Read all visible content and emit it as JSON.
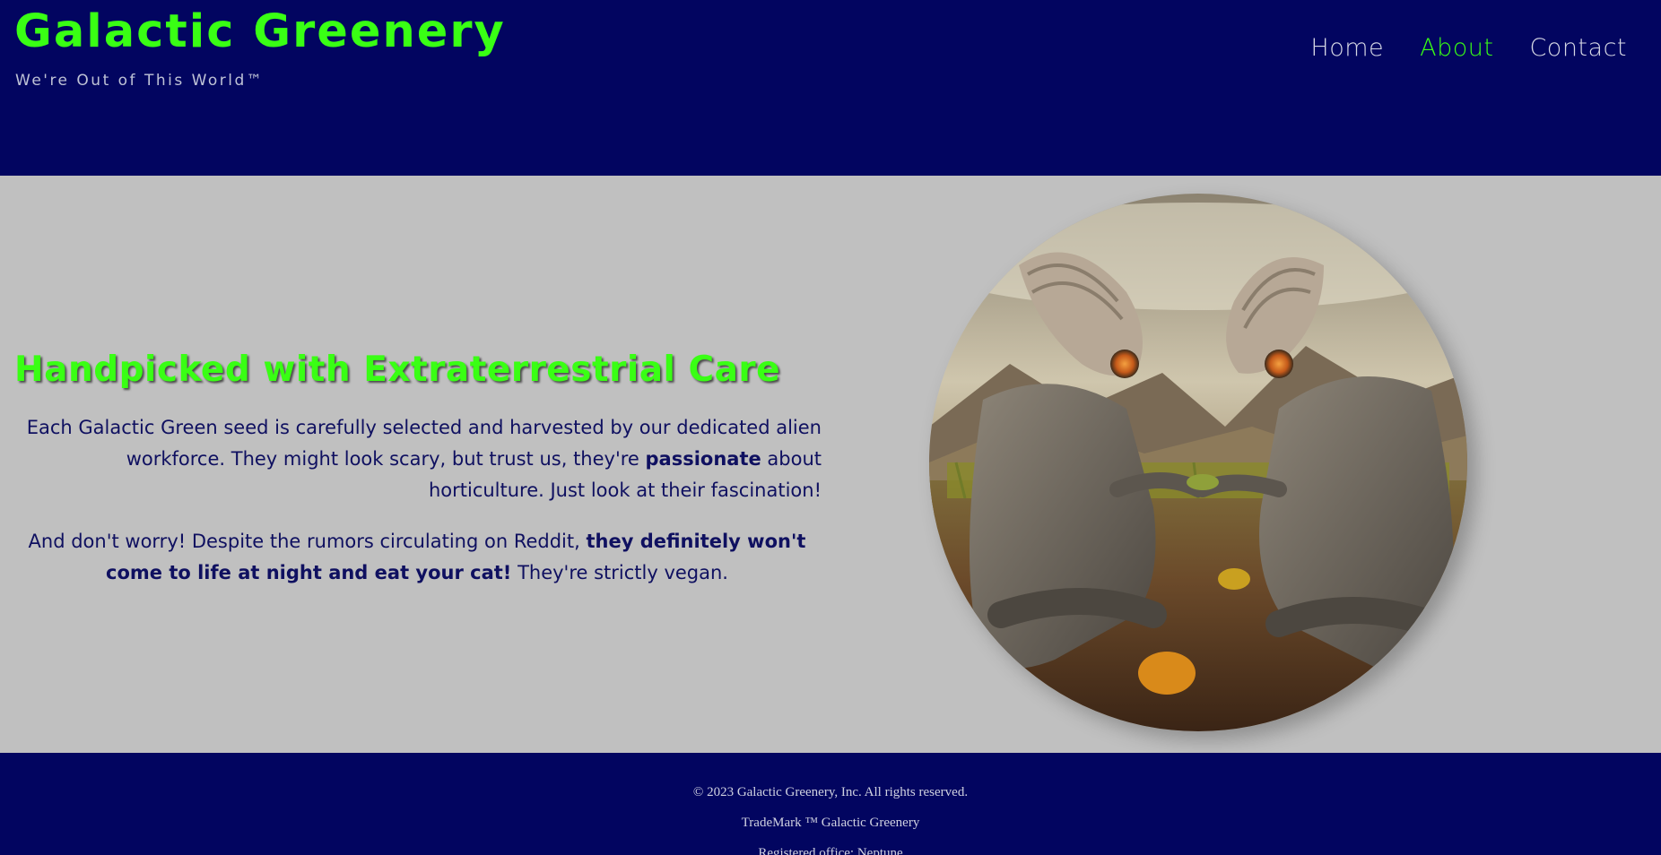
{
  "header": {
    "title": "Galactic Greenery",
    "tagline": "We're Out of This World™",
    "nav": [
      {
        "label": "Home",
        "active": false
      },
      {
        "label": "About",
        "active": true
      },
      {
        "label": "Contact",
        "active": false
      }
    ]
  },
  "main": {
    "heading": "Handpicked with Extraterrestrial Care",
    "paragraph1": {
      "before": "Each Galactic Green seed is carefully selected and harvested by our dedicated alien workforce. They might look scary, but trust us, they're ",
      "bold": "passionate",
      "after": " about horticulture. Just look at their fascination!"
    },
    "paragraph2": {
      "before": "And don't worry! Despite the rumors circulating on Reddit, ",
      "bold": "they definitely won't come to life at night and eat your cat!",
      "after": " They're strictly vegan."
    },
    "image_subject": "two-aliens-tending-crops-image"
  },
  "footer": {
    "copyright": "© 2023 Galactic Greenery, Inc. All rights reserved.",
    "trademark": "TradeMark ™ Galactic Greenery",
    "office": "Registered office: Neptune"
  },
  "colors": {
    "header_bg": "#020560",
    "accent": "#39ff14",
    "body_bg": "#c0c0c0",
    "text": "#0f1060"
  }
}
